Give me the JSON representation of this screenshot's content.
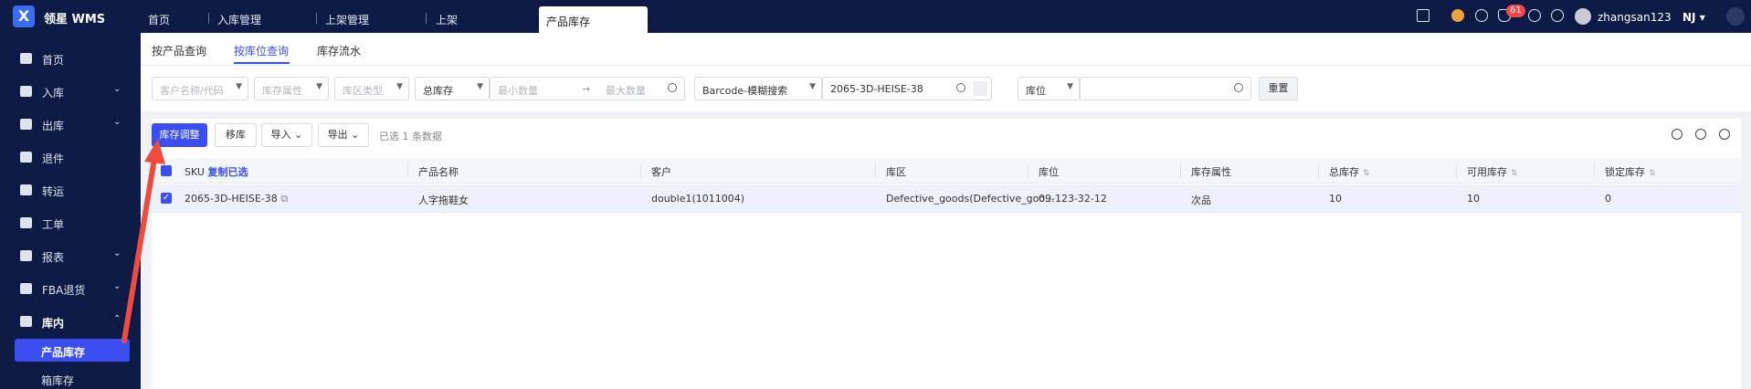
{
  "app": {
    "brand": "领星 WMS",
    "logo_text": "X"
  },
  "top_tabs": [
    "首页",
    "入库管理",
    "上架管理",
    "上架"
  ],
  "active_top_tab": "产品库存",
  "header_right": {
    "notifications": "61",
    "username": "zhangsan123",
    "org": "NJ"
  },
  "sidebar": {
    "items": [
      {
        "label": "首页",
        "chevron": ""
      },
      {
        "label": "入库",
        "chevron": "⌄"
      },
      {
        "label": "出库",
        "chevron": "⌄"
      },
      {
        "label": "退件",
        "chevron": ""
      },
      {
        "label": "转运",
        "chevron": ""
      },
      {
        "label": "工单",
        "chevron": ""
      },
      {
        "label": "报表",
        "chevron": "⌄"
      },
      {
        "label": "FBA退货",
        "chevron": "⌄"
      },
      {
        "label": "库内",
        "chevron": "⌃"
      }
    ],
    "active_sub": "产品库存",
    "next_sub": "箱库存"
  },
  "sub_tabs": [
    "按产品查询",
    "按库位查询",
    "库存流水"
  ],
  "filters": {
    "customer_ph": "客户名称/代码",
    "attr_ph": "库存属性",
    "zone_ph": "库区类型",
    "stock_type": "总库存",
    "min_ph": "最小数量",
    "range_arrow": "→",
    "max_ph": "最大数量",
    "search_type": "Barcode-模糊搜索",
    "barcode_value": "2065-3D-HEISE-38",
    "location_type": "库位",
    "reset": "重置"
  },
  "actions": {
    "adjust": "库存调整",
    "move": "移库",
    "import": "导入",
    "export": "导出",
    "selected_info": "已选 1 条数据"
  },
  "table": {
    "headers": {
      "sku": "SKU",
      "copy": "复制已选",
      "name": "产品名称",
      "customer": "客户",
      "zone": "库区",
      "location": "库位",
      "attr": "库存属性",
      "total": "总库存",
      "available": "可用库存",
      "locked": "锁定库存"
    },
    "rows": [
      {
        "sku": "2065-3D-HEISE-38",
        "name": "人字拖鞋女",
        "customer": "double1(1011004)",
        "zone": "Defective_goods(Defective_goo...",
        "location": "09-123-32-12",
        "attr": "次品",
        "total": "10",
        "available": "10",
        "locked": "0"
      }
    ]
  },
  "colors": {
    "nav_bg": "#0c1a45",
    "accent": "#3b4ef0",
    "arrow": "#ee4b3f"
  }
}
